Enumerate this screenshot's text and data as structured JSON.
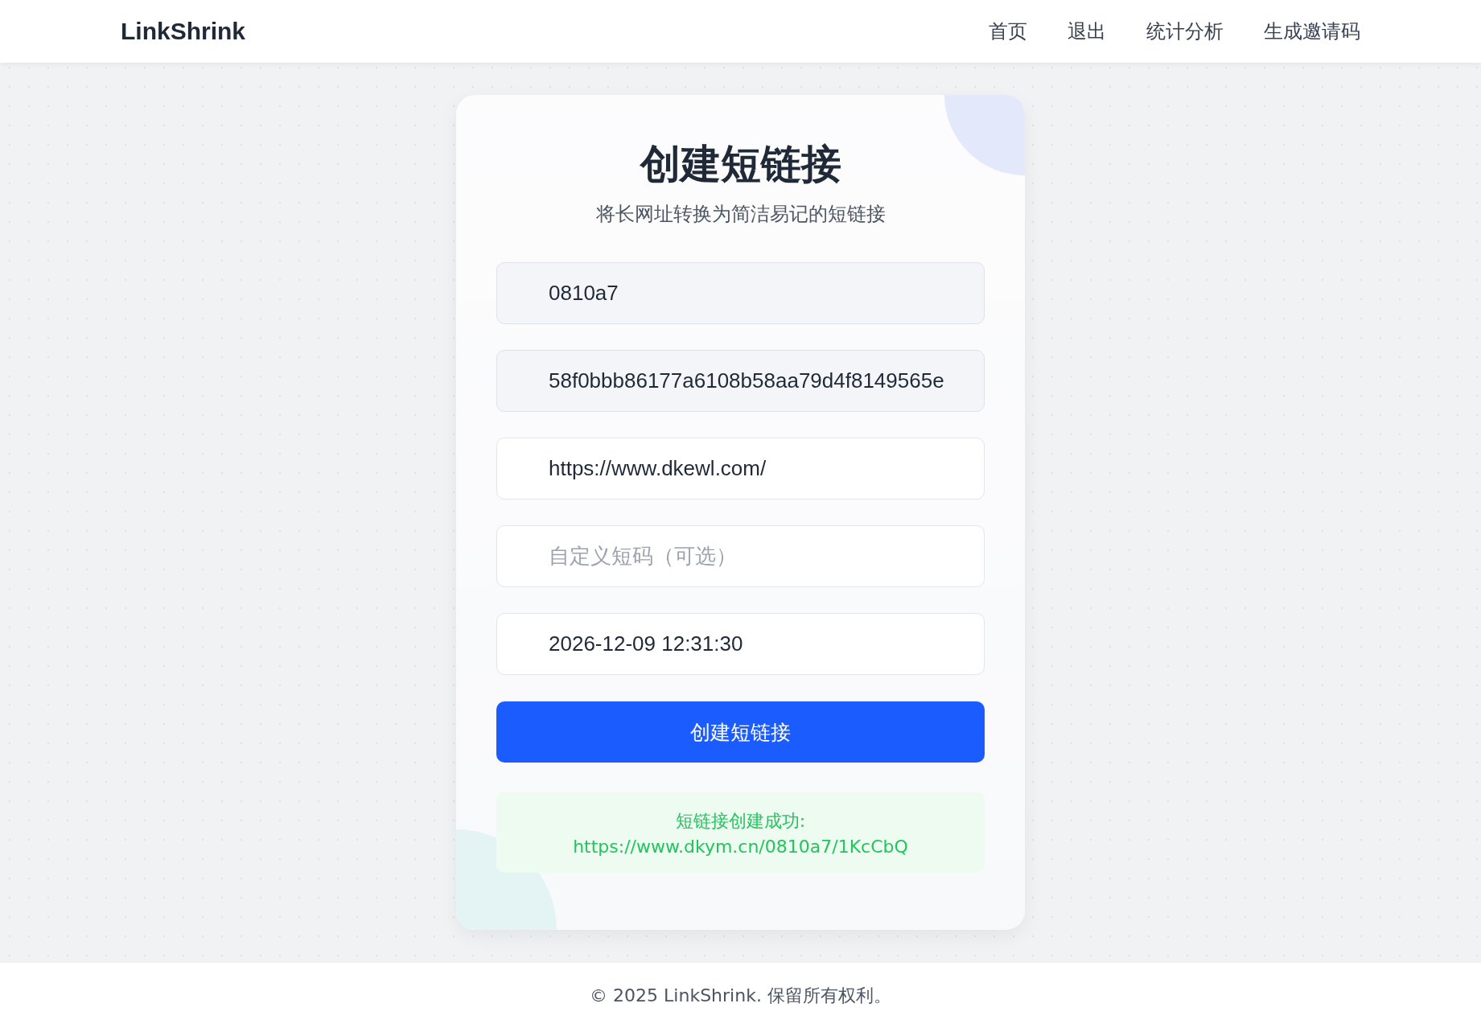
{
  "header": {
    "brand": "LinkShrink",
    "nav": [
      {
        "label": "首页"
      },
      {
        "label": "退出"
      },
      {
        "label": "统计分析"
      },
      {
        "label": "生成邀请码"
      }
    ]
  },
  "card": {
    "title": "创建短链接",
    "subtitle": "将长网址转换为简洁易记的短链接",
    "fields": [
      {
        "value": "0810a7",
        "disabled": true
      },
      {
        "value": "58f0bbb86177a6108b58aa79d4f8149565e",
        "disabled": true
      },
      {
        "value": "https://www.dkewl.com/",
        "disabled": false
      },
      {
        "placeholder": "自定义短码（可选）",
        "disabled": false
      },
      {
        "value": "2026-12-09 12:31:30",
        "disabled": false
      }
    ],
    "submit": "创建短链接",
    "result": {
      "message": "短链接创建成功:",
      "link": "https://www.dkym.cn/0810a7/1KcCbQ"
    }
  },
  "footer": {
    "text": "© 2025 LinkShrink. 保留所有权利。"
  }
}
